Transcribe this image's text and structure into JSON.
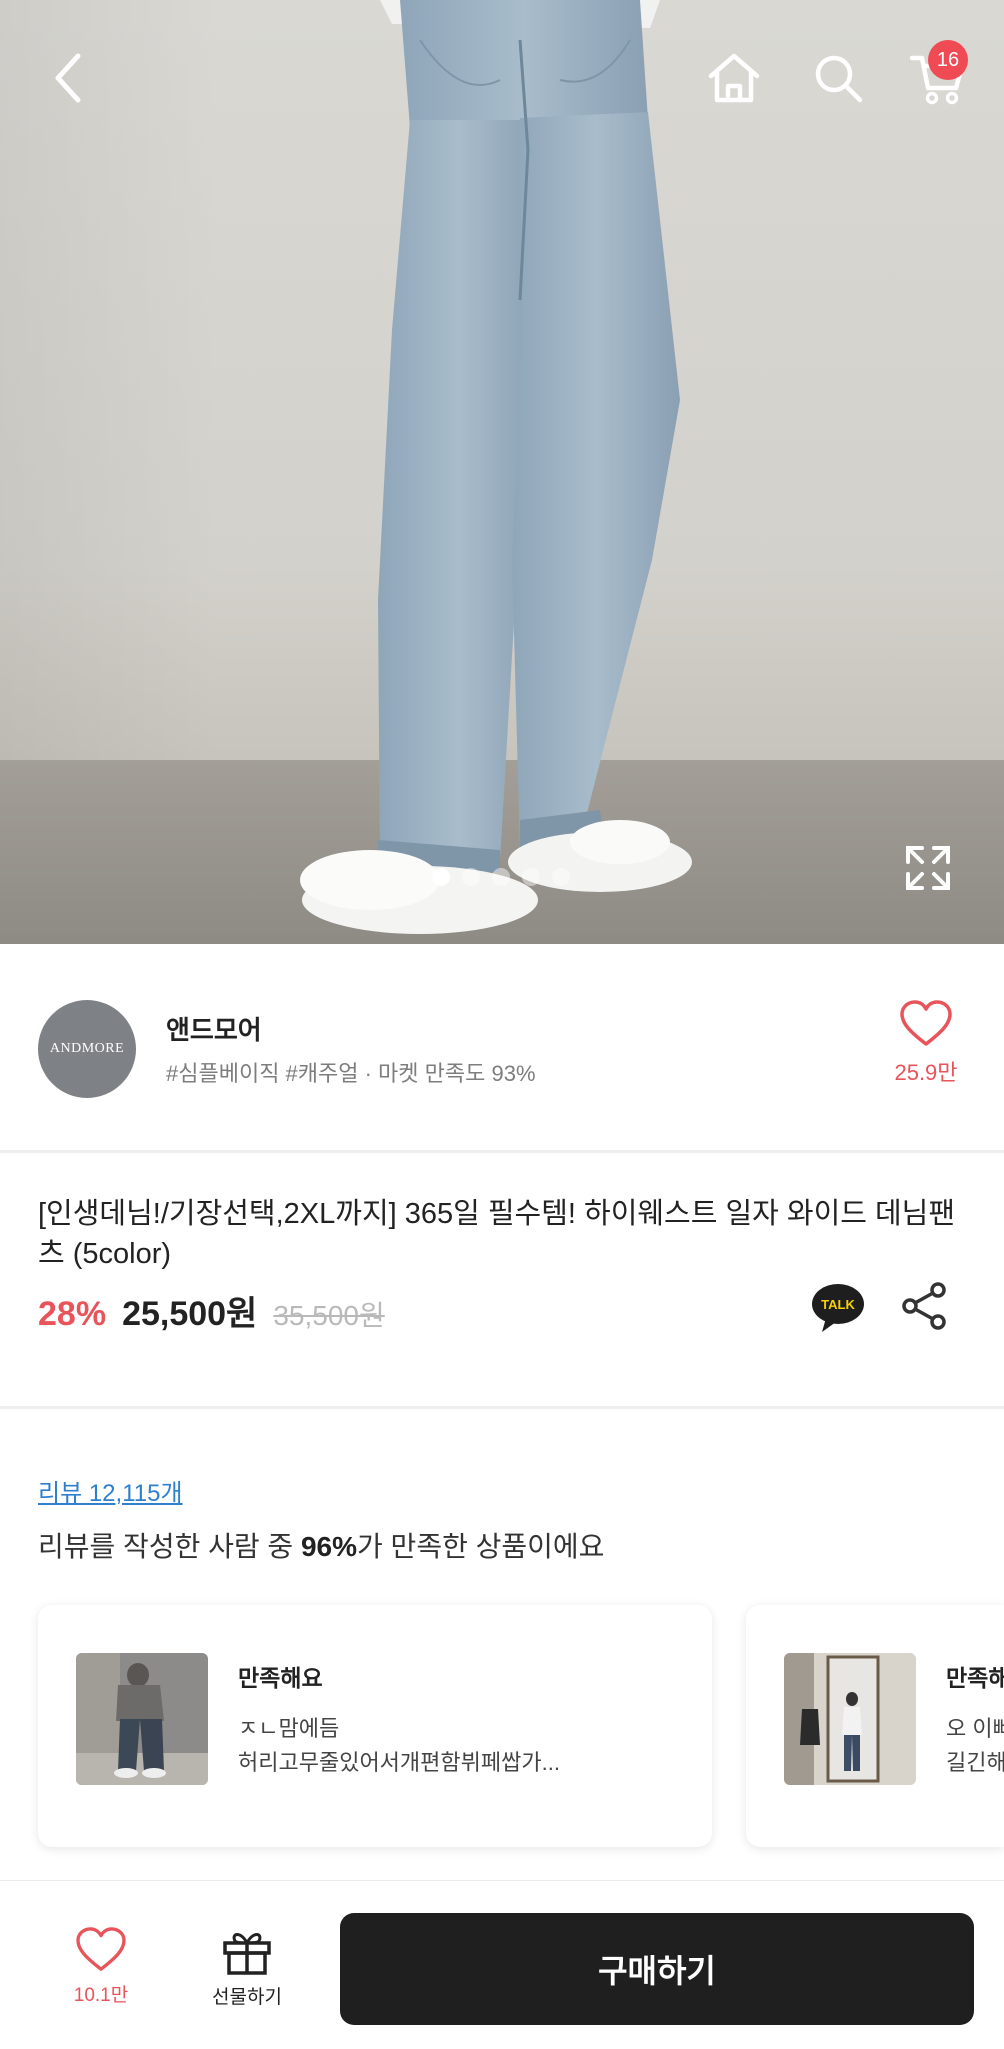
{
  "header": {
    "cart_count": "16"
  },
  "gallery": {
    "total_images": 5,
    "active_index": 0
  },
  "seller": {
    "logo_text": "ANDMORE",
    "name": "앤드모어",
    "tags": "#심플베이직 #캐주얼 · 마켓 만족도 93%",
    "like_count": "25.9만"
  },
  "product": {
    "title": "[인생데님!/기장선택,2XL까지] 365일 필수템! 하이웨스트 일자 와이드 데님팬츠 (5color)",
    "discount": "28%",
    "price": "25,500원",
    "original_price": "35,500원"
  },
  "talk_button": {
    "label": "TALK"
  },
  "reviews": {
    "link_text": "리뷰 12,115개",
    "summary_prefix": "리뷰를 작성한 사람 중 ",
    "summary_highlight": "96%",
    "summary_suffix": "가 만족한 상품이에요",
    "items": [
      {
        "title": "만족해요",
        "line1": "ㅈㄴ맘에듬",
        "line2": "허리고무줄있어서개편함뷔페쌉가..."
      },
      {
        "title": "만족해요",
        "line1": "오 이뻐요",
        "line2": "길긴해요"
      }
    ]
  },
  "bottom_bar": {
    "like_count": "10.1만",
    "gift_label": "선물하기",
    "buy_label": "구매하기"
  },
  "colors": {
    "accent": "#e8545a",
    "badge": "#f04a54",
    "link": "#2f7fcf",
    "buy_button": "#1f1f1f"
  }
}
